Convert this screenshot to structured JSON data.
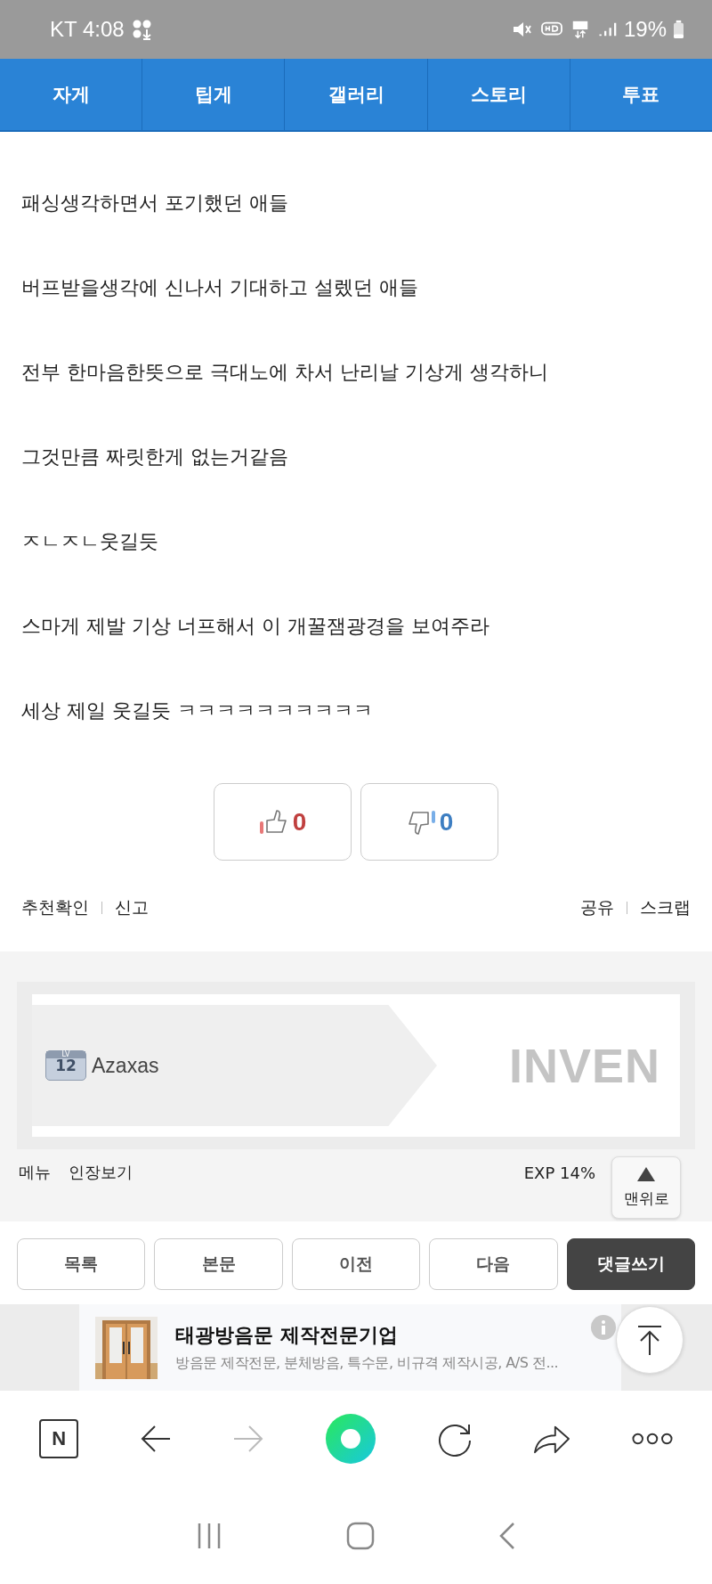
{
  "status_bar": {
    "carrier": "KT",
    "time": "4:08",
    "battery": "19%"
  },
  "nav_tabs": [
    {
      "label": "자게",
      "selected": false
    },
    {
      "label": "팁게",
      "selected": false
    },
    {
      "label": "갤러리",
      "selected": false
    },
    {
      "label": "스토리",
      "selected": false
    },
    {
      "label": "투표",
      "selected": false
    }
  ],
  "post_lines": [
    "패싱생각하면서 포기했던 애들",
    "버프받을생각에 신나서 기대하고 설렜던 애들",
    "전부 한마음한뜻으로 극대노에 차서 난리날 기상게 생각하니",
    "그것만큼 짜릿한게 없는거같음",
    "ㅈㄴㅈㄴ웃길듯",
    "스마게 제발 기상 너프해서 이 개꿀잼광경을 보여주라",
    "세상 제일 웃길듯 ㅋㅋㅋㅋㅋㅋㅋㅋㅋㅋ"
  ],
  "votes": {
    "up": "0",
    "down": "0"
  },
  "actions_left": [
    "추천확인",
    "신고"
  ],
  "actions_right": [
    "공유",
    "스크랩"
  ],
  "profile": {
    "level_label": "LV",
    "level": "12",
    "name": "Azaxas",
    "logo": "INVEN"
  },
  "profile_links": [
    "메뉴",
    "인장보기"
  ],
  "exp": "EXP 14%",
  "scroll_top_label": "맨위로",
  "buttons": [
    {
      "label": "목록",
      "kind": "plain"
    },
    {
      "label": "본문",
      "kind": "plain"
    },
    {
      "label": "이전",
      "kind": "plain"
    },
    {
      "label": "다음",
      "kind": "plain"
    },
    {
      "label": "댓글쓰기",
      "kind": "primary"
    }
  ],
  "ad": {
    "title": "태광방음문 제작전문기업",
    "description": "방음문 제작전문, 분체방음, 특수문, 비규격 제작시공, A/S 전..."
  },
  "browser_bar": {
    "home_letter": "N",
    "forward_disabled": true
  }
}
